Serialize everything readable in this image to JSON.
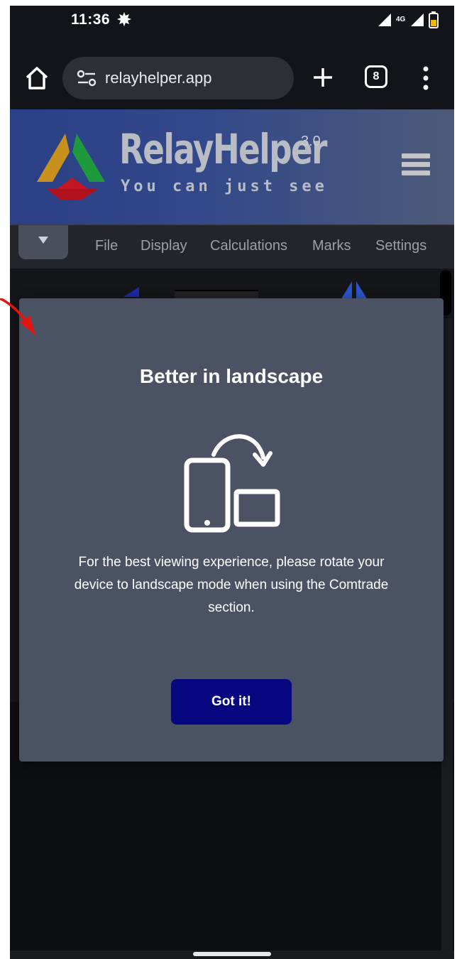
{
  "status_bar": {
    "time": "11:36",
    "network": "4G"
  },
  "browser": {
    "url": "relayhelper.app",
    "tab_count": "8"
  },
  "header": {
    "brand": "RelayHelper",
    "version": "3.0",
    "tagline": "You can just see"
  },
  "menubar": {
    "items": [
      {
        "label": "File"
      },
      {
        "label": "Display"
      },
      {
        "label": "Calculations"
      },
      {
        "label": "Marks"
      },
      {
        "label": "Settings"
      }
    ]
  },
  "modal": {
    "title": "Better in landscape",
    "message": "For the best viewing experience, please rotate your device to landscape mode when using the Comtrade section.",
    "button_label": "Got it!",
    "icon": "rotate-device-icon"
  },
  "colors": {
    "modal_bg": "#4a5263",
    "button_bg": "#07077f",
    "header_bg": "#2a3f86",
    "annotation_arrow": "#e3140f"
  }
}
